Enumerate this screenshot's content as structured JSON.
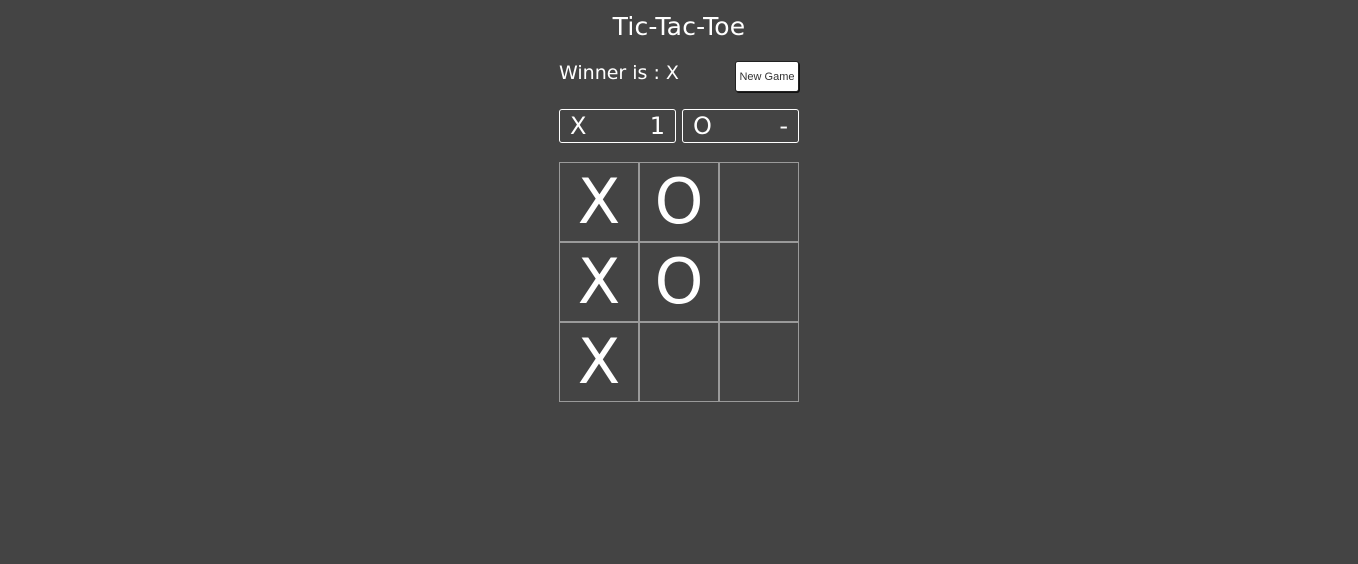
{
  "title": "Tic-Tac-Toe",
  "status": {
    "winner_text": "Winner is : X",
    "new_game_label": "New Game"
  },
  "scores": {
    "x": {
      "player": "X",
      "value": "1"
    },
    "o": {
      "player": "O",
      "value": "-"
    }
  },
  "board": {
    "cells": [
      "X",
      "O",
      "",
      "X",
      "O",
      "",
      "X",
      "",
      ""
    ]
  },
  "colors": {
    "background": "#444444",
    "foreground": "#ffffff",
    "cell_border": "#9a9a9a"
  }
}
